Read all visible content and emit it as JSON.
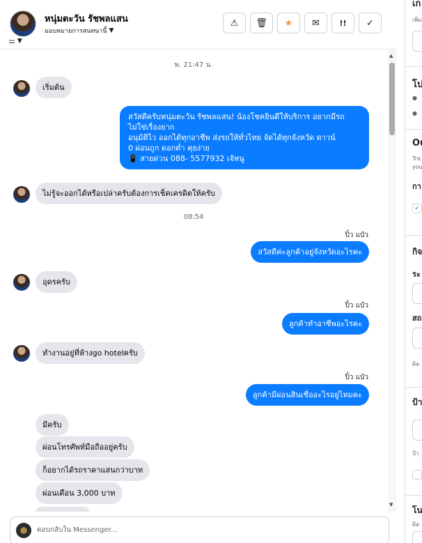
{
  "header": {
    "contact_name": "หนุ่มตะวัน รัชพลแสน",
    "assign_label": "มอบหมายการสนทนานี้",
    "actions": [
      {
        "icon": "warning-icon",
        "glyph": "⚠"
      },
      {
        "icon": "trash-icon",
        "glyph": "🗑"
      },
      {
        "icon": "star-icon",
        "glyph": "★"
      },
      {
        "icon": "mail-icon",
        "glyph": "✉"
      },
      {
        "icon": "follow-up-icon",
        "glyph": "!!"
      },
      {
        "icon": "check-icon",
        "glyph": "✓"
      }
    ],
    "filter_glyph": "⚙▾"
  },
  "thread": {
    "timestamp_1": "พ. 21:47 น.",
    "msg_1": "เริ่มต้น",
    "msg_2_lines": [
      "สวัสดีครับหนุ่มตะวัน รัชพลแสน! น้องโชคยินดีให้บริการ อยากมีรถ",
      "ไม่ใช่เรื่องยาก",
      "อนุมัติไว ออกได้ทุกอาชีพ ส่งรถให้ทั่วไทย จัดได้ทุกจังหวัด ดาวน์",
      "0  ผ่อนถูก ดอกต่ำ คุยง่าย",
      "📱 สายด่วน 088- 5577932 เจ้หนู"
    ],
    "msg_3": "ไม่รู้จะออกได้หรือเปล่าครับต้องการเช็คเครดิตให้ครับ",
    "timestamp_2": "08:54",
    "sender_1": "ปิ๋ว แป๋ว",
    "msg_4": "สวัสดีค่ะลูกค้าอยู่จังหวัดอะไรคะ",
    "msg_5": "อุดรครับ",
    "sender_2": "ปิ๋ว แป๋ว",
    "msg_6": "ลูกค้าทำอาชีพอะไรคะ",
    "msg_7": "ทำงานอยู่ที่ห้างgo hotelครับ",
    "sender_3": "ปิ๋ว แป๋ว",
    "msg_8": "ลูกค้ามีผ่อนสินเชื่ออะไรอยู่ไหมคะ",
    "msg_9": "มีครับ",
    "msg_10": "ผ่อนโทรศัพท์มือถืออยู่ครับ",
    "msg_11": "ก็อยากได้รถราคาแสนกว่าบาท",
    "msg_12": "ผ่อนเดือน 3,000 บาท"
  },
  "composer": {
    "placeholder": "ตอบกลับใน Messenger..."
  },
  "right_panel": {
    "frag_1": "เก",
    "frag_2": "เพิ่ม",
    "frag_3": "โป",
    "frag_4": "Ou",
    "frag_5": "Tra",
    "frag_6": "you",
    "frag_7": "กา",
    "frag_8": "กิจ",
    "frag_9": "ระ",
    "frag_10": "สถ",
    "frag_11": "ติด",
    "frag_12": "ป้า",
    "frag_13": "ป้า",
    "frag_14": "โน",
    "frag_15": "ติด"
  }
}
